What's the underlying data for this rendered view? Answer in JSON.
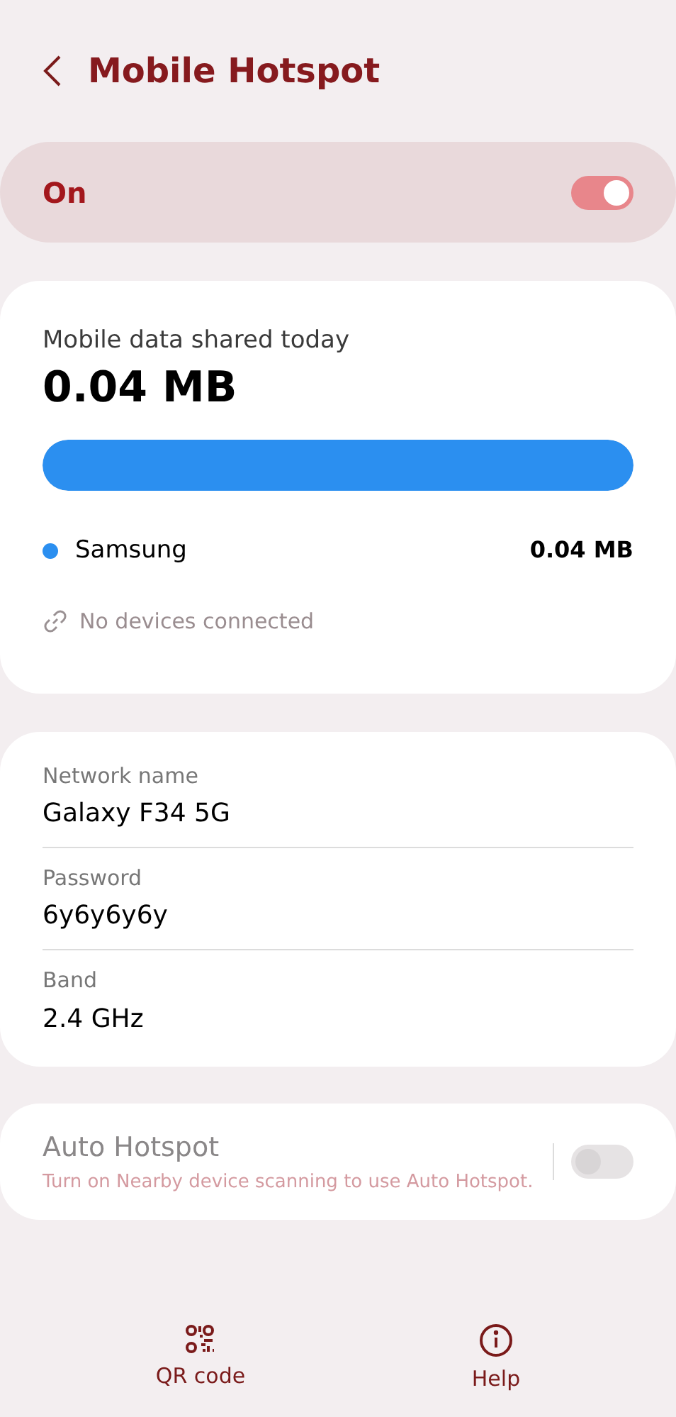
{
  "header": {
    "title": "Mobile Hotspot"
  },
  "master_switch": {
    "label": "On",
    "on": true
  },
  "usage": {
    "label": "Mobile data shared today",
    "total": "0.04 MB",
    "level": 1,
    "devices": [
      {
        "name": "Samsung",
        "amount": "0.04 MB",
        "color": "#2b8ff0"
      }
    ],
    "status": "No devices connected"
  },
  "network": [
    {
      "label": "Network name",
      "value": "Galaxy F34 5G"
    },
    {
      "label": "Password",
      "value": "6y6y6y6y"
    },
    {
      "label": "Band",
      "value": "2.4 GHz"
    }
  ],
  "auto_hotspot": {
    "title": "Auto Hotspot",
    "subtitle": "Turn on Nearby device scanning to use Auto Hotspot.",
    "on": false,
    "disabled": true
  },
  "bottom_bar": [
    {
      "kind": "qr",
      "label": "QR code"
    },
    {
      "kind": "help",
      "label": "Help"
    }
  ]
}
